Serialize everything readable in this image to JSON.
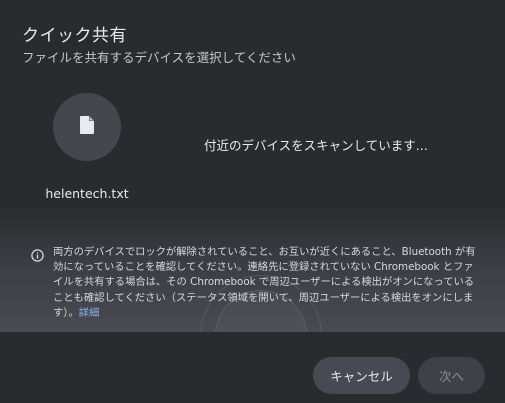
{
  "dialog": {
    "title": "クイック共有",
    "subtitle": "ファイルを共有するデバイスを選択してください"
  },
  "file": {
    "name": "helentech.txt",
    "icon": "file-icon"
  },
  "status": {
    "text": "付近のデバイスをスキャンしています..."
  },
  "info": {
    "icon": "info-icon",
    "text": "両方のデバイスでロックが解除されていること、お互いが近くにあること、Bluetooth が有効になっていることを確認してください。連絡先に登録されていない Chromebook とファイルを共有する場合は、その Chromebook で周辺ユーザーによる検出がオンになっていることも確認してください（ステータス領域を開いて、周辺ユーザーによる検出をオンにします）。",
    "link_label": "詳細"
  },
  "buttons": {
    "cancel_label": "キャンセル",
    "next_label": "次へ"
  },
  "colors": {
    "background": "#2a2b2e",
    "link": "#8ab4f8",
    "cancel_button": "#474a51",
    "next_button_disabled": "#3f4146"
  }
}
